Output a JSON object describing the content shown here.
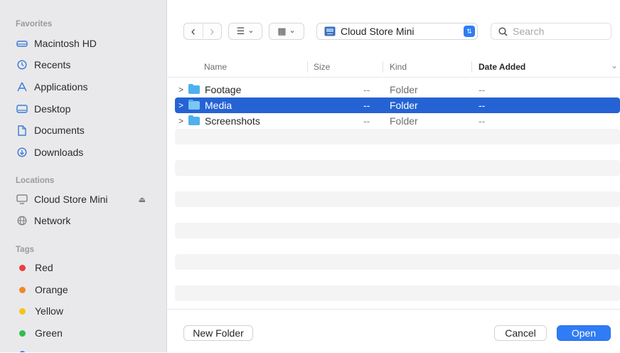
{
  "sidebar": {
    "favorites_header": "Favorites",
    "favorites": [
      {
        "label": "Macintosh HD",
        "icon": "hard-drive-icon"
      },
      {
        "label": "Recents",
        "icon": "clock-icon"
      },
      {
        "label": "Applications",
        "icon": "applications-icon"
      },
      {
        "label": "Desktop",
        "icon": "desktop-icon"
      },
      {
        "label": "Documents",
        "icon": "document-icon"
      },
      {
        "label": "Downloads",
        "icon": "download-icon"
      }
    ],
    "locations_header": "Locations",
    "locations": [
      {
        "label": "Cloud Store Mini",
        "icon": "drive-icon",
        "eject": "⏏"
      },
      {
        "label": "Network",
        "icon": "network-icon"
      }
    ],
    "tags_header": "Tags",
    "tags": [
      {
        "label": "Red",
        "color": "#ee3b3b"
      },
      {
        "label": "Orange",
        "color": "#f08a24"
      },
      {
        "label": "Yellow",
        "color": "#f5c518"
      },
      {
        "label": "Green",
        "color": "#2ebd4f"
      }
    ]
  },
  "toolbar": {
    "back": "‹",
    "forward": "›",
    "list_view": "☰",
    "grid_view": "▦",
    "chevron": "⌄",
    "location": "Cloud Store Mini",
    "stepper": "⇅",
    "search_placeholder": "Search"
  },
  "columns": {
    "name": "Name",
    "size": "Size",
    "kind": "Kind",
    "date_added": "Date Added",
    "sort_chevron": "⌄"
  },
  "rows": [
    {
      "name": "Footage",
      "size": "--",
      "kind": "Folder",
      "date": "--",
      "selected": false
    },
    {
      "name": "Media",
      "size": "--",
      "kind": "Folder",
      "date": "--",
      "selected": true
    },
    {
      "name": "Screenshots",
      "size": "--",
      "kind": "Folder",
      "date": "--",
      "selected": false
    }
  ],
  "footer": {
    "new_folder": "New Folder",
    "cancel": "Cancel",
    "open": "Open"
  },
  "colors": {
    "accent": "#2f7cf6",
    "selection": "#2563d4",
    "folder": "#4fb0ee",
    "sidebar_bg": "#e9e9ec"
  }
}
